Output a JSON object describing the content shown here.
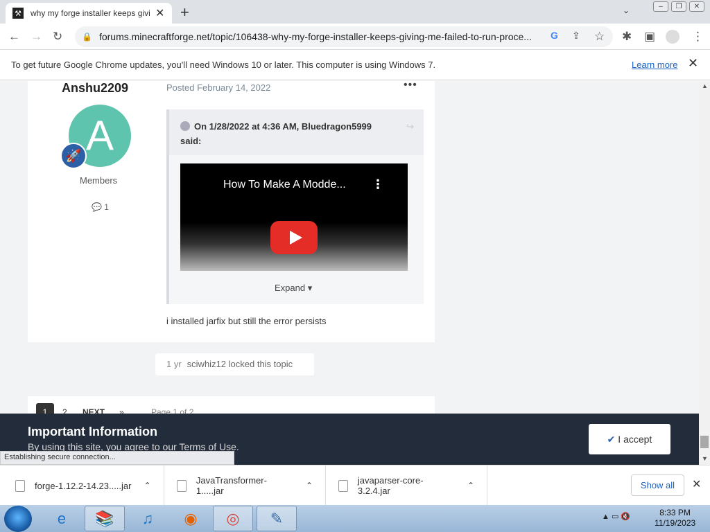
{
  "browser": {
    "tab_title": "why my forge installer keeps giving",
    "url": "forums.minecraftforge.net/topic/106438-why-my-forge-installer-keeps-giving-me-failed-to-run-proce...",
    "infobar_message": "To get future Google Chrome updates, you'll need Windows 10 or later. This computer is using Windows 7.",
    "infobar_link": "Learn more",
    "status_text": "Establishing secure connection..."
  },
  "post": {
    "author": "Anshu2209",
    "posted": "Posted February 14, 2022",
    "avatar_letter": "A",
    "group": "Members",
    "post_count": "1",
    "quote_header": "On 1/28/2022 at 4:36 AM, Bluedragon5999",
    "quote_said": "said:",
    "video_title": "How To Make A Modde...",
    "expand_label": "Expand",
    "content": "i installed jarfix but still the error persists"
  },
  "locked": {
    "ago": "1 yr",
    "text": "sciwhiz12 locked this topic"
  },
  "pagination": {
    "page1": "1",
    "page2": "2",
    "next": "NEXT",
    "last": "»",
    "page_of": "Page 1 of 2"
  },
  "banner": {
    "heading": "Important Information",
    "body": "By using this site, you agree to our Terms of Use.",
    "accept_label": "I accept"
  },
  "downloads": {
    "items": [
      {
        "name": "forge-1.12.2-14.23.....jar"
      },
      {
        "name": "JavaTransformer-1.....jar"
      },
      {
        "name": "javaparser-core-3.2.4.jar"
      }
    ],
    "show_all": "Show all"
  },
  "taskbar": {
    "time": "8:33 PM",
    "date": "11/19/2023"
  },
  "colors": {
    "avatar": "#5fc4ad",
    "banner_bg": "#232c3b",
    "link": "#1a62c8"
  }
}
